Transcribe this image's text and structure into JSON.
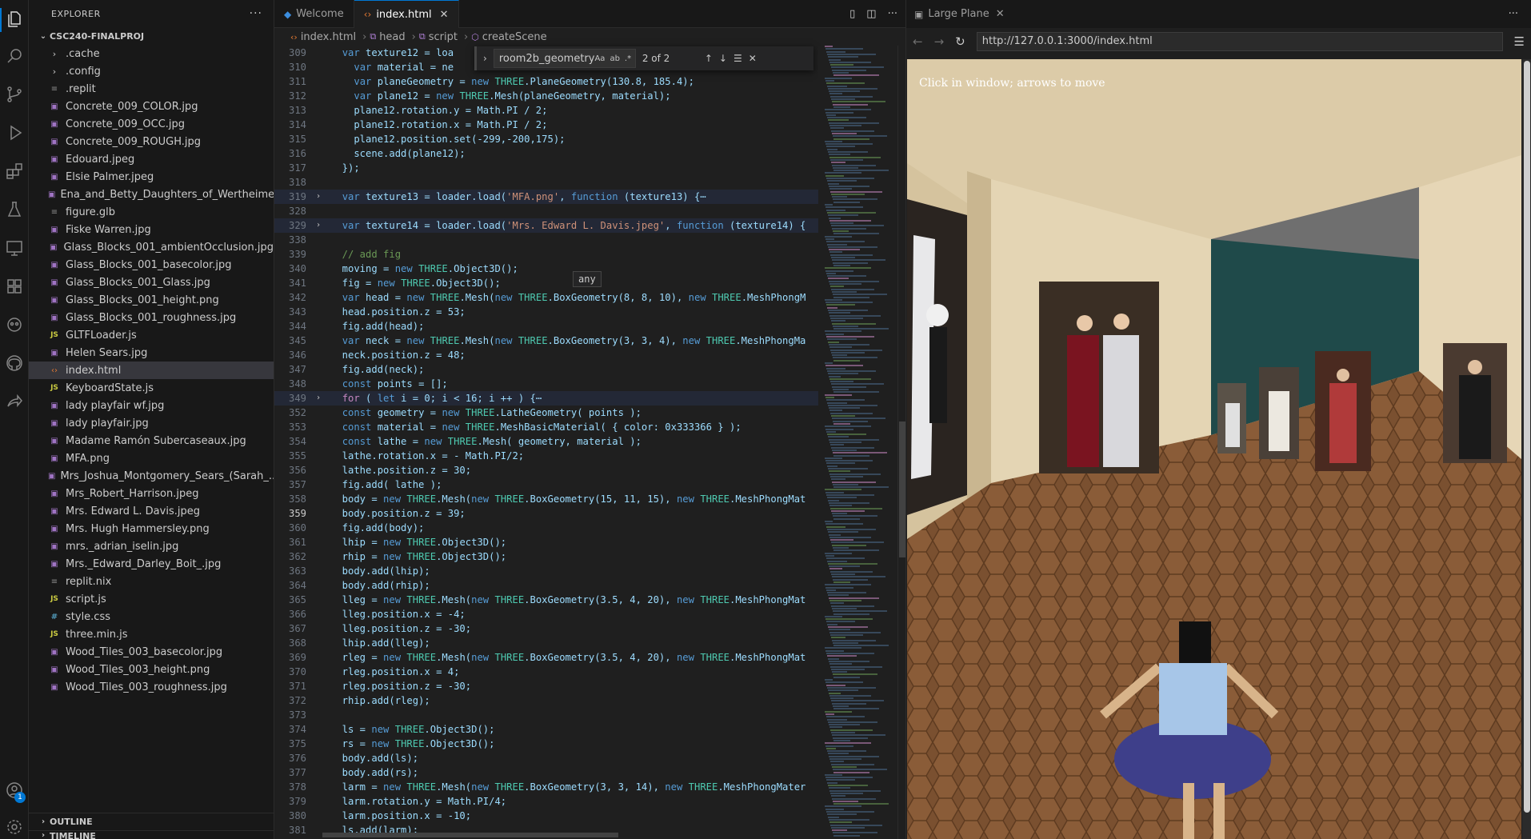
{
  "sidebar": {
    "title": "EXPLORER",
    "root": "CSC240-FINALPROJ",
    "items": [
      {
        "name": ".cache",
        "type": "folder"
      },
      {
        "name": ".config",
        "type": "folder"
      },
      {
        "name": ".replit",
        "type": "txt"
      },
      {
        "name": "Concrete_009_COLOR.jpg",
        "type": "img"
      },
      {
        "name": "Concrete_009_OCC.jpg",
        "type": "img"
      },
      {
        "name": "Concrete_009_ROUGH.jpg",
        "type": "img"
      },
      {
        "name": "Edouard.jpeg",
        "type": "img"
      },
      {
        "name": "Elsie Palmer.jpeg",
        "type": "img"
      },
      {
        "name": "Ena_and_Betty_Daughters_of_Wertheimer...",
        "type": "img"
      },
      {
        "name": "figure.glb",
        "type": "glb"
      },
      {
        "name": "Fiske Warren.jpg",
        "type": "img"
      },
      {
        "name": "Glass_Blocks_001_ambientOcclusion.jpg",
        "type": "img"
      },
      {
        "name": "Glass_Blocks_001_basecolor.jpg",
        "type": "img"
      },
      {
        "name": "Glass_Blocks_001_Glass.jpg",
        "type": "img"
      },
      {
        "name": "Glass_Blocks_001_height.png",
        "type": "img"
      },
      {
        "name": "Glass_Blocks_001_roughness.jpg",
        "type": "img"
      },
      {
        "name": "GLTFLoader.js",
        "type": "js"
      },
      {
        "name": "Helen Sears.jpg",
        "type": "img"
      },
      {
        "name": "index.html",
        "type": "html",
        "active": true
      },
      {
        "name": "KeyboardState.js",
        "type": "js"
      },
      {
        "name": "lady playfair wf.jpg",
        "type": "img"
      },
      {
        "name": "lady playfair.jpg",
        "type": "img"
      },
      {
        "name": "Madame Ramón Subercaseaux.jpg",
        "type": "img"
      },
      {
        "name": "MFA.png",
        "type": "img"
      },
      {
        "name": "Mrs_Joshua_Montgomery_Sears_(Sarah_...",
        "type": "img"
      },
      {
        "name": "Mrs_Robert_Harrison.jpeg",
        "type": "img"
      },
      {
        "name": "Mrs. Edward L. Davis.jpeg",
        "type": "img"
      },
      {
        "name": "Mrs. Hugh Hammersley.png",
        "type": "img"
      },
      {
        "name": "mrs._adrian_iselin.jpg",
        "type": "img"
      },
      {
        "name": "Mrs._Edward_Darley_Boit_.jpg",
        "type": "img"
      },
      {
        "name": "replit.nix",
        "type": "txt"
      },
      {
        "name": "script.js",
        "type": "js"
      },
      {
        "name": "style.css",
        "type": "css"
      },
      {
        "name": "three.min.js",
        "type": "js"
      },
      {
        "name": "Wood_Tiles_003_basecolor.jpg",
        "type": "img"
      },
      {
        "name": "Wood_Tiles_003_height.png",
        "type": "img"
      },
      {
        "name": "Wood_Tiles_003_roughness.jpg",
        "type": "img"
      }
    ],
    "outline": "OUTLINE",
    "timeline": "TIMELINE",
    "account_badge": "1"
  },
  "editor": {
    "tabs": [
      {
        "label": "Welcome",
        "active": false
      },
      {
        "label": "index.html",
        "active": true
      }
    ],
    "breadcrumb": [
      "index.html",
      "head",
      "script",
      "createScene"
    ],
    "find": {
      "query": "room2b_geometry",
      "count": "2 of 2",
      "opts": [
        "Aa",
        "ab",
        ".*"
      ]
    },
    "tooltip": "any",
    "current_line": "359",
    "lines": [
      {
        "n": "309",
        "code": "  var texture12 = loa"
      },
      {
        "n": "310",
        "code": "    var material = ne"
      },
      {
        "n": "311",
        "code": "    var planeGeometry = new THREE.PlaneGeometry(130.8, 185.4);"
      },
      {
        "n": "312",
        "code": "    var plane12 = new THREE.Mesh(planeGeometry, material);"
      },
      {
        "n": "313",
        "code": "    plane12.rotation.y = Math.PI / 2;"
      },
      {
        "n": "314",
        "code": "    plane12.rotation.x = Math.PI / 2;"
      },
      {
        "n": "315",
        "code": "    plane12.position.set(-299,-200,175);"
      },
      {
        "n": "316",
        "code": "    scene.add(plane12);"
      },
      {
        "n": "317",
        "code": "  });"
      },
      {
        "n": "318",
        "code": ""
      },
      {
        "n": "319",
        "code": "  var texture13 = loader.load('MFA.png', function (texture13) {⋯",
        "fold": true,
        "hl": true
      },
      {
        "n": "328",
        "code": ""
      },
      {
        "n": "329",
        "code": "  var texture14 = loader.load('Mrs. Edward L. Davis.jpeg', function (texture14) {",
        "fold": true,
        "hl": true
      },
      {
        "n": "338",
        "code": ""
      },
      {
        "n": "339",
        "code": "  // add fig"
      },
      {
        "n": "340",
        "code": "  moving = new THREE.Object3D();"
      },
      {
        "n": "341",
        "code": "  fig = new THREE.Object3D();"
      },
      {
        "n": "342",
        "code": "  var head = new THREE.Mesh(new THREE.BoxGeometry(8, 8, 10), new THREE.MeshPhongM"
      },
      {
        "n": "343",
        "code": "  head.position.z = 53;"
      },
      {
        "n": "344",
        "code": "  fig.add(head);"
      },
      {
        "n": "345",
        "code": "  var neck = new THREE.Mesh(new THREE.BoxGeometry(3, 3, 4), new THREE.MeshPhongMa"
      },
      {
        "n": "346",
        "code": "  neck.position.z = 48;"
      },
      {
        "n": "347",
        "code": "  fig.add(neck);"
      },
      {
        "n": "348",
        "code": "  const points = [];"
      },
      {
        "n": "349",
        "code": "  for ( let i = 0; i < 16; i ++ ) {⋯",
        "fold": true,
        "hl": true
      },
      {
        "n": "352",
        "code": "  const geometry = new THREE.LatheGeometry( points );"
      },
      {
        "n": "353",
        "code": "  const material = new THREE.MeshBasicMaterial( { color: 0x333366 } );"
      },
      {
        "n": "354",
        "code": "  const lathe = new THREE.Mesh( geometry, material );"
      },
      {
        "n": "355",
        "code": "  lathe.rotation.x = - Math.PI/2;"
      },
      {
        "n": "356",
        "code": "  lathe.position.z = 30;"
      },
      {
        "n": "357",
        "code": "  fig.add( lathe );"
      },
      {
        "n": "358",
        "code": "  body = new THREE.Mesh(new THREE.BoxGeometry(15, 11, 15), new THREE.MeshPhongMat"
      },
      {
        "n": "359",
        "code": "  body.position.z = 39;"
      },
      {
        "n": "360",
        "code": "  fig.add(body);"
      },
      {
        "n": "361",
        "code": "  lhip = new THREE.Object3D();"
      },
      {
        "n": "362",
        "code": "  rhip = new THREE.Object3D();"
      },
      {
        "n": "363",
        "code": "  body.add(lhip);"
      },
      {
        "n": "364",
        "code": "  body.add(rhip);"
      },
      {
        "n": "365",
        "code": "  lleg = new THREE.Mesh(new THREE.BoxGeometry(3.5, 4, 20), new THREE.MeshPhongMat"
      },
      {
        "n": "366",
        "code": "  lleg.position.x = -4;"
      },
      {
        "n": "367",
        "code": "  lleg.position.z = -30;"
      },
      {
        "n": "368",
        "code": "  lhip.add(lleg);"
      },
      {
        "n": "369",
        "code": "  rleg = new THREE.Mesh(new THREE.BoxGeometry(3.5, 4, 20), new THREE.MeshPhongMat"
      },
      {
        "n": "370",
        "code": "  rleg.position.x = 4;"
      },
      {
        "n": "371",
        "code": "  rleg.position.z = -30;"
      },
      {
        "n": "372",
        "code": "  rhip.add(rleg);"
      },
      {
        "n": "373",
        "code": ""
      },
      {
        "n": "374",
        "code": "  ls = new THREE.Object3D();"
      },
      {
        "n": "375",
        "code": "  rs = new THREE.Object3D();"
      },
      {
        "n": "376",
        "code": "  body.add(ls);"
      },
      {
        "n": "377",
        "code": "  body.add(rs);"
      },
      {
        "n": "378",
        "code": "  larm = new THREE.Mesh(new THREE.BoxGeometry(3, 3, 14), new THREE.MeshPhongMater"
      },
      {
        "n": "379",
        "code": "  larm.rotation.y = Math.PI/4;"
      },
      {
        "n": "380",
        "code": "  larm.position.x = -10;"
      },
      {
        "n": "381",
        "code": "  ls.add(larm);"
      }
    ]
  },
  "browser": {
    "tab": "Large Plane",
    "url": "http://127.0.0.1:3000/index.html",
    "scene_text": "Click in window; arrows to move"
  },
  "colors": {
    "accent": "#0078d4",
    "wall": "#dccba8",
    "accent_wall": "#1f4a4a",
    "floor": "#7a5030",
    "skirt": "#3e3f8a",
    "shirt": "#a7c6e8"
  }
}
